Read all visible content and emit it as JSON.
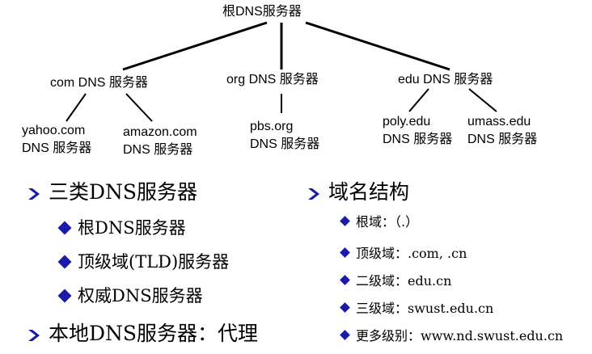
{
  "tree": {
    "root": "根DNS服务器",
    "tld": [
      {
        "label": "com DNS 服务器"
      },
      {
        "label": "org DNS 服务器"
      },
      {
        "label": "edu DNS 服务器"
      }
    ],
    "leaves": [
      {
        "line1": "yahoo.com",
        "line2": "DNS 服务器"
      },
      {
        "line1": "amazon.com",
        "line2": "DNS 服务器"
      },
      {
        "line1": "pbs.org",
        "line2": "DNS 服务器"
      },
      {
        "line1": "poly.edu",
        "line2": "DNS 服务器"
      },
      {
        "line1": "umass.edu",
        "line2": "DNS 服务器"
      }
    ]
  },
  "left_list": {
    "heading1": "三类DNS服务器",
    "items": [
      "根DNS服务器",
      "顶级域(TLD)服务器",
      "权威DNS服务器"
    ],
    "heading2": "本地DNS服务器：代理"
  },
  "right_list": {
    "heading": "域名结构",
    "items": [
      "根域：（.）",
      "顶级域：.com, .cn",
      "二级域：edu.cn",
      "三级域：swust.edu.cn",
      "更多级别：www.nd.swust.edu.cn"
    ]
  },
  "colors": {
    "bullet": "#1a1aa8",
    "arrow": "#1a1aa8",
    "text": "#000000"
  },
  "icons": {
    "arrow": "arrow-bullet-icon",
    "diamond": "diamond-bullet-icon"
  }
}
